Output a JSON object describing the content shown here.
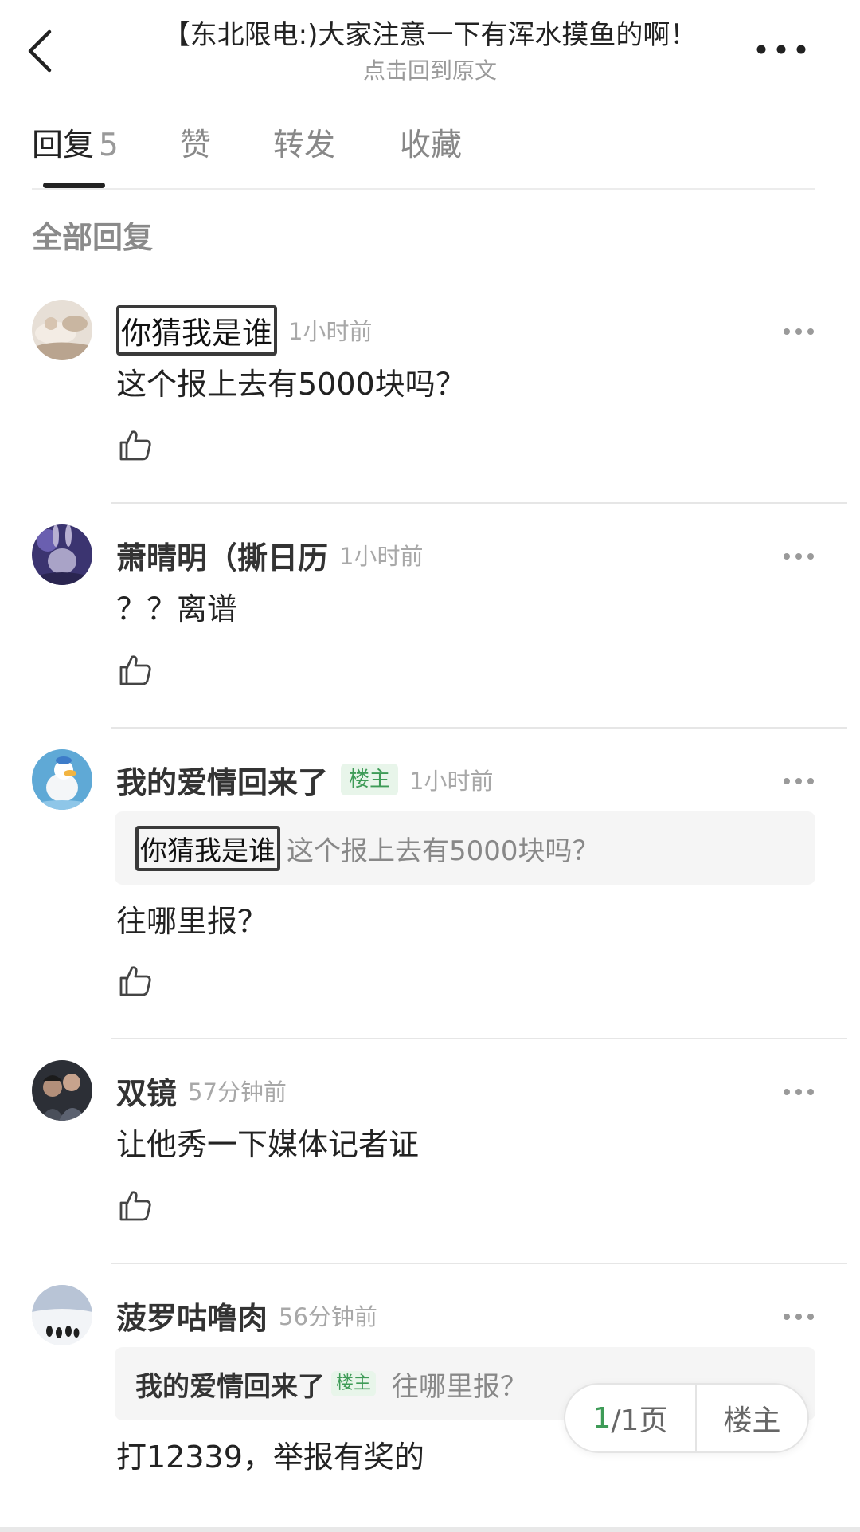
{
  "header": {
    "title": "【东北限电:)大家注意一下有浑水摸鱼的啊！",
    "subtitle": "点击回到原文",
    "back_icon": "chevron-left-icon",
    "more_icon": "more-horizontal-icon"
  },
  "tabs": [
    {
      "label": "回复",
      "count": "5",
      "active": true
    },
    {
      "label": "赞"
    },
    {
      "label": "转发"
    },
    {
      "label": "收藏"
    }
  ],
  "section_title": "全部回复",
  "comments": [
    {
      "user": "你猜我是谁",
      "time": "1小时前",
      "content": "这个报上去有5000块吗？"
    },
    {
      "user": "萧晴明（撕日历",
      "time": "1小时前",
      "content": "？？离谱"
    },
    {
      "user": "我的爱情回来了",
      "badge": "楼主",
      "time": "1小时前",
      "quote": {
        "user": "你猜我是谁",
        "text": "这个报上去有5000块吗？"
      },
      "content": "往哪里报？"
    },
    {
      "user": "双镜",
      "time": "57分钟前",
      "content": "让他秀一下媒体记者证"
    },
    {
      "user": "菠罗咕噜肉",
      "time": "56分钟前",
      "quote": {
        "user": "我的爱情回来了",
        "badge": "楼主",
        "text": "往哪里报？"
      },
      "content": "打12339，举报有奖的"
    }
  ],
  "pager": {
    "current": "1",
    "rest": "/1页",
    "op_label": "楼主"
  },
  "colors": {
    "accent_green": "#3e9b57",
    "badge_bg": "#e8f5ea",
    "muted_text": "#a8a8a8"
  }
}
